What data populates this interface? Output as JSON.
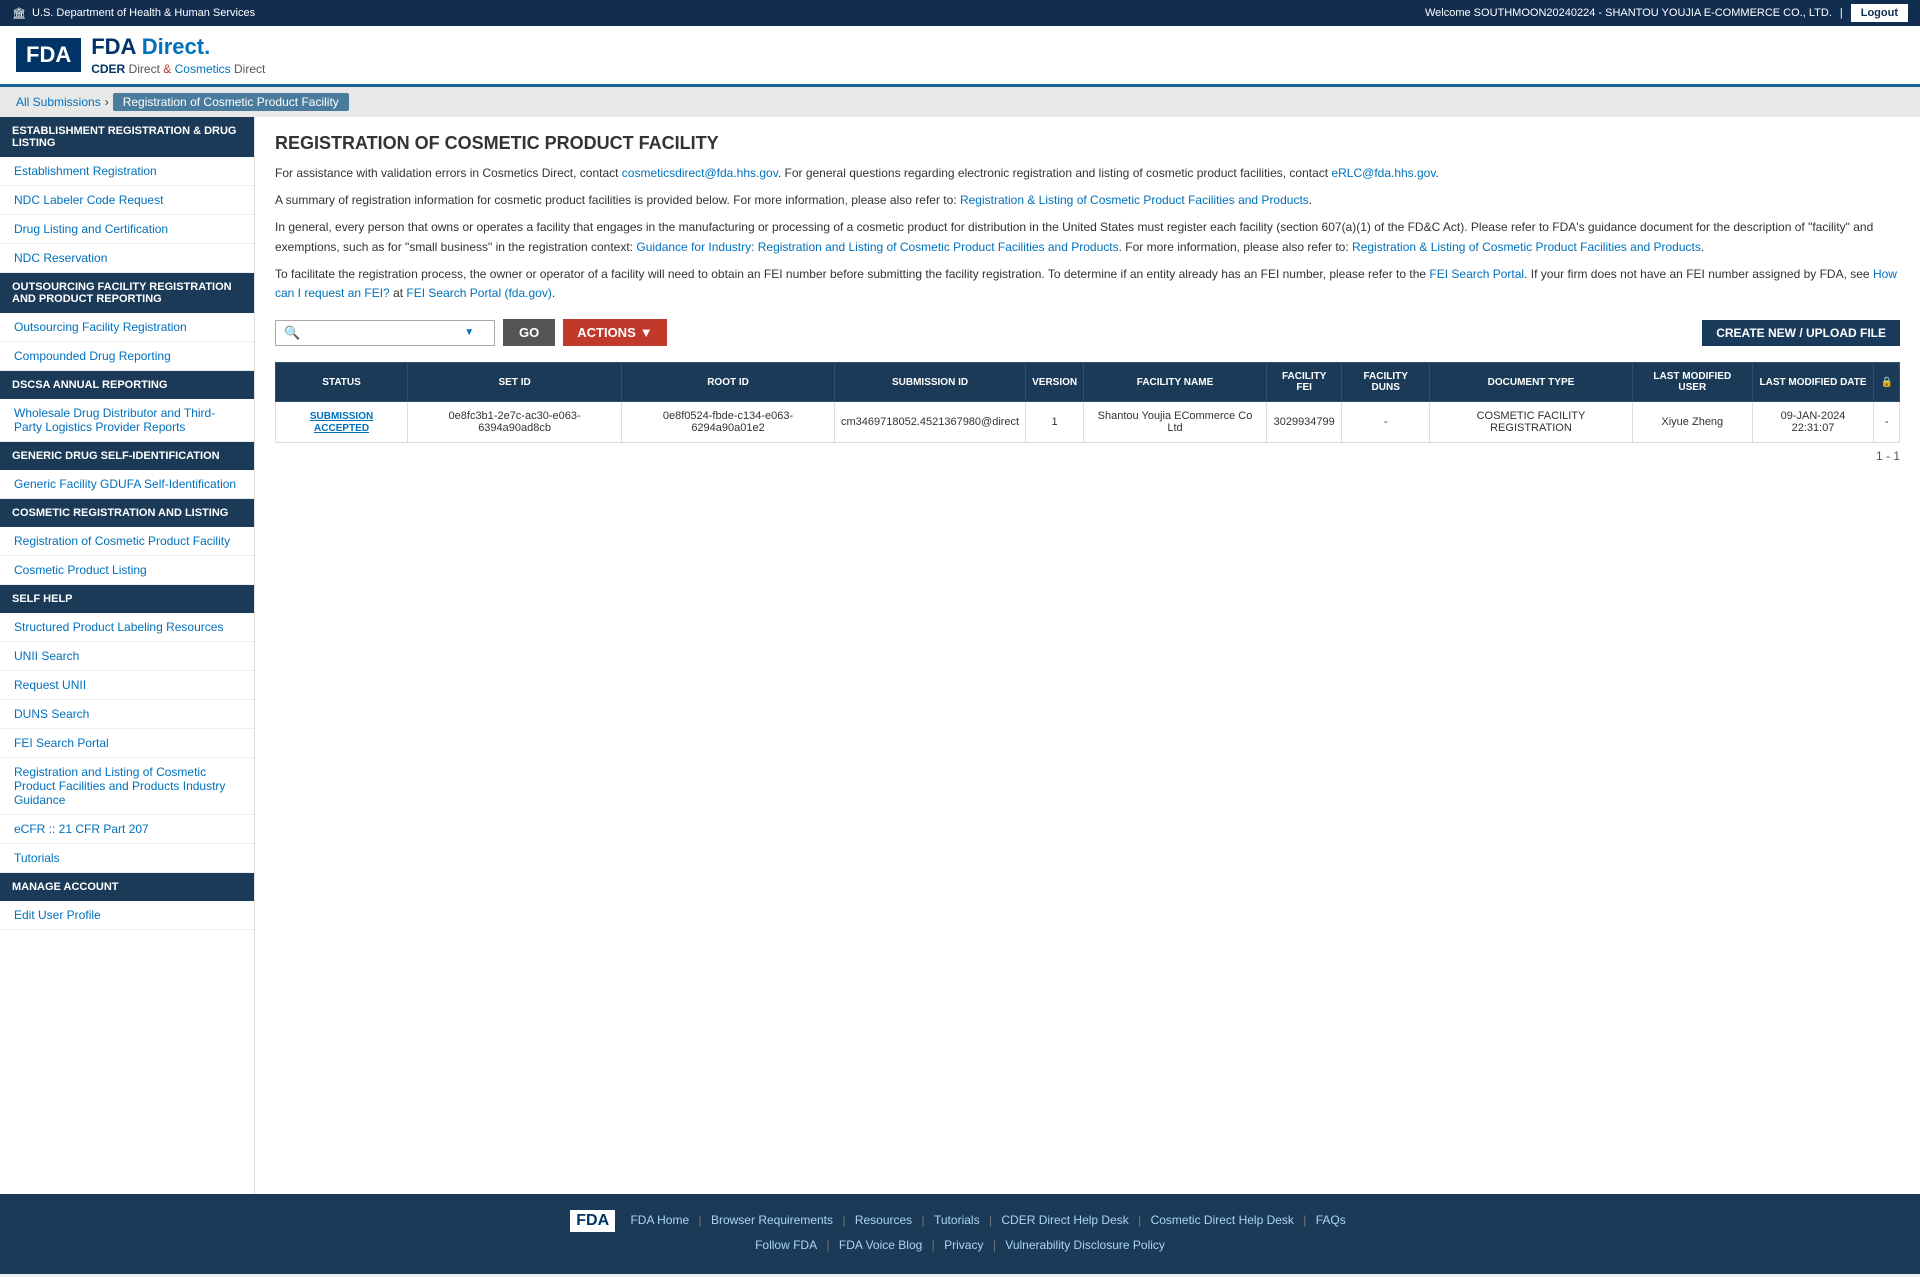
{
  "govBar": {
    "agency": "U.S. Department of Health & Human Services",
    "welcomeText": "Welcome SOUTHMOON20240224 - SHANTOU YOUJIA E-COMMERCE CO., LTD.",
    "logoutLabel": "Logout"
  },
  "header": {
    "fdaLabel": "FDA",
    "directLabel": "FDA Direct.",
    "subLabel": "CDER Direct & Cosmetics Direct"
  },
  "breadcrumb": {
    "allSubmissions": "All Submissions",
    "current": "Registration of Cosmetic Product Facility"
  },
  "sidebar": {
    "sections": [
      {
        "id": "establishment",
        "header": "ESTABLISHMENT REGISTRATION & DRUG LISTING",
        "items": [
          "Establishment Registration",
          "NDC Labeler Code Request",
          "Drug Listing and Certification",
          "NDC Reservation"
        ]
      },
      {
        "id": "outsourcing",
        "header": "OUTSOURCING FACILITY REGISTRATION AND PRODUCT REPORTING",
        "items": [
          "Outsourcing Facility Registration",
          "Compounded Drug Reporting"
        ]
      },
      {
        "id": "dscsa",
        "header": "DSCSA ANNUAL REPORTING",
        "items": [
          "Wholesale Drug Distributor and Third-Party Logistics Provider Reports"
        ]
      },
      {
        "id": "generic",
        "header": "GENERIC DRUG SELF-IDENTIFICATION",
        "items": [
          "Generic Facility GDUFA Self-Identification"
        ]
      },
      {
        "id": "cosmetic",
        "header": "COSMETIC REGISTRATION AND LISTING",
        "items": [
          "Registration of Cosmetic Product Facility",
          "Cosmetic Product Listing"
        ]
      },
      {
        "id": "selfhelp",
        "header": "SELF HELP",
        "items": [
          "Structured Product Labeling Resources",
          "UNII Search",
          "Request UNII",
          "DUNS Search",
          "FEI Search Portal",
          "Registration and Listing of Cosmetic Product Facilities and Products Industry Guidance",
          "eCFR :: 21 CFR Part 207",
          "Tutorials"
        ]
      },
      {
        "id": "manage",
        "header": "MANAGE ACCOUNT",
        "items": [
          "Edit User Profile"
        ]
      }
    ]
  },
  "content": {
    "pageTitle": "REGISTRATION OF COSMETIC PRODUCT FACILITY",
    "paragraph1": "For assistance with validation errors in Cosmetics Direct, contact cosmeticsdirect@fda.hhs.gov. For general questions regarding electronic registration and listing of cosmetic product facilities, contact eRLC@fda.hhs.gov.",
    "paragraph2": "A summary of registration information for cosmetic product facilities is provided below. For more information, please also refer to: Registration & Listing of Cosmetic Product Facilities and Products.",
    "paragraph3": "In general, every person that owns or operates a facility that engages in the manufacturing or processing of a cosmetic product for distribution in the United States must register each facility (section 607(a)(1) of the FD&C Act). Please refer to FDA's guidance document for the description of \"facility\" and exemptions, such as for \"small business\" in the registration context: Guidance for Industry: Registration and Listing of Cosmetic Product Facilities and Products. For more information, please also refer to: Registration & Listing of Cosmetic Product Facilities and Products.",
    "paragraph4": "To facilitate the registration process, the owner or operator of a facility will need to obtain an FEI number before submitting the facility registration. To determine if an entity already has an FEI number, please refer to the FEI Search Portal. If your firm does not have an FEI number assigned by FDA, see How can I request an FEI? at FEI Search Portal (fda.gov).",
    "searchPlaceholder": "",
    "goLabel": "GO",
    "actionsLabel": "ACTIONS",
    "createLabel": "CREATE NEW / UPLOAD FILE",
    "tableHeaders": [
      "STATUS",
      "SET ID",
      "ROOT ID",
      "SUBMISSION ID",
      "VERSION",
      "FACILITY NAME",
      "FACILITY FEI",
      "FACILITY DUNS",
      "DOCUMENT TYPE",
      "LAST MODIFIED USER",
      "LAST MODIFIED DATE",
      ""
    ],
    "tableRows": [
      {
        "status": "SUBMISSION ACCEPTED",
        "setId": "0e8fc3b1-2e7c-ac30-e063-6394a90ad8cb",
        "rootId": "0e8f0524-fbde-c134-e063-6294a90a01e2",
        "submissionId": "cm3469718052.4521367980@direct",
        "version": "1",
        "facilityName": "Shantou Youjia ECommerce Co Ltd",
        "facilityFei": "3029934799",
        "facilityDuns": "-",
        "documentType": "COSMETIC FACILITY REGISTRATION",
        "lastModifiedUser": "Xiyue Zheng",
        "lastModifiedDate": "09-JAN-2024 22:31:07",
        "lock": "-"
      }
    ],
    "pagination": "1 - 1"
  },
  "footer": {
    "links1": [
      "FDA Home",
      "Browser Requirements",
      "Resources",
      "Tutorials",
      "CDER Direct Help Desk",
      "Cosmetic Direct Help Desk",
      "FAQs"
    ],
    "links2": [
      "Follow FDA",
      "FDA Voice Blog",
      "Privacy",
      "Vulnerability Disclosure Policy"
    ]
  }
}
